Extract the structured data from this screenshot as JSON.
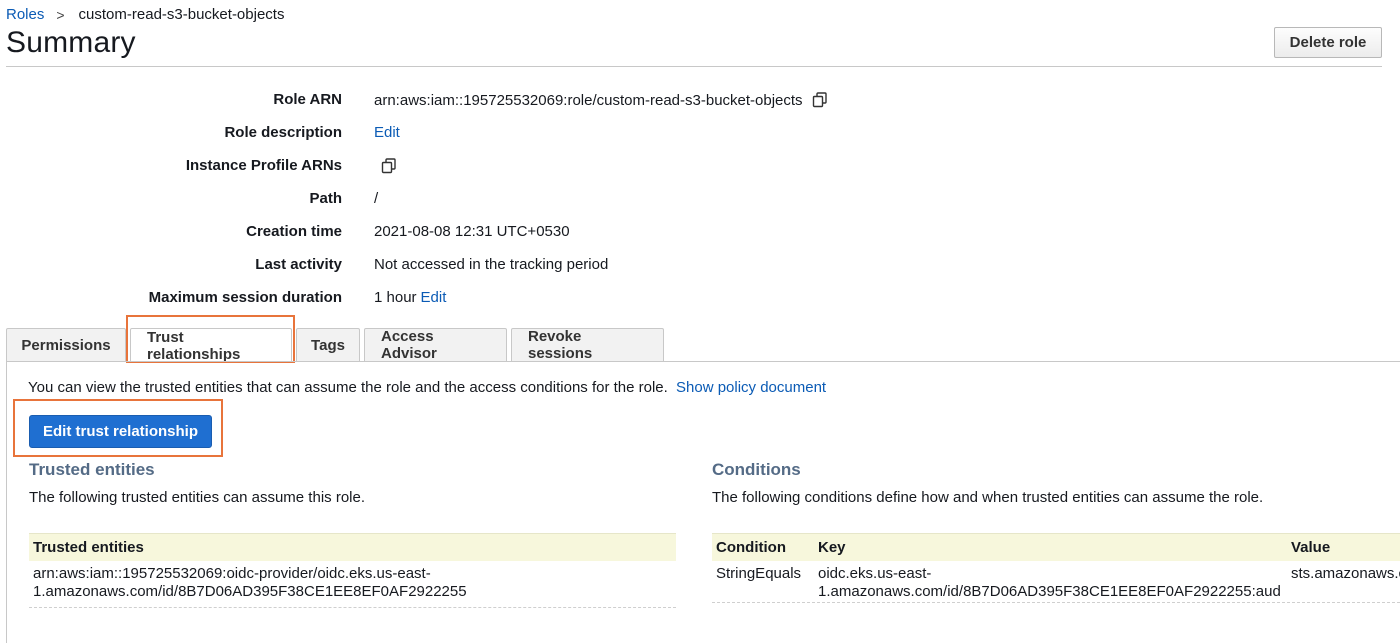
{
  "breadcrumb": {
    "parent": "Roles",
    "separator": ">",
    "current": "custom-read-s3-bucket-objects"
  },
  "page_title": "Summary",
  "delete_button": "Delete role",
  "summary": {
    "role_arn_label": "Role ARN",
    "role_arn_value": "arn:aws:iam::195725532069:role/custom-read-s3-bucket-objects",
    "role_description_label": "Role description",
    "role_description_edit": "Edit",
    "instance_profile_label": "Instance Profile ARNs",
    "path_label": "Path",
    "path_value": "/",
    "creation_time_label": "Creation time",
    "creation_time_value": "2021-08-08 12:31 UTC+0530",
    "last_activity_label": "Last activity",
    "last_activity_value": "Not accessed in the tracking period",
    "max_session_label": "Maximum session duration",
    "max_session_value": "1 hour",
    "max_session_edit": "Edit"
  },
  "tabs": [
    "Permissions",
    "Trust relationships",
    "Tags",
    "Access Advisor",
    "Revoke sessions"
  ],
  "active_tab": "Trust relationships",
  "trust": {
    "intro": "You can view the trusted entities that can assume the role and the access conditions for the role.",
    "show_policy_link": "Show policy document",
    "edit_button": "Edit trust relationship",
    "trusted_entities_title": "Trusted entities",
    "trusted_entities_desc": "The following trusted entities can assume this role.",
    "trusted_entities_header": "Trusted entities",
    "trusted_entities_rows": [
      {
        "line1": "arn:aws:iam::195725532069:oidc-provider/oidc.eks.us-east-",
        "line2": "1.amazonaws.com/id/8B7D06AD395F38CE1EE8EF0AF2922255"
      }
    ],
    "conditions_title": "Conditions",
    "conditions_desc": "The following conditions define how and when trusted entities can assume the role.",
    "conditions_headers": {
      "condition": "Condition",
      "key": "Key",
      "value": "Value"
    },
    "conditions_rows": [
      {
        "condition": "StringEquals",
        "key_line1": "oidc.eks.us-east-",
        "key_line2": "1.amazonaws.com/id/8B7D06AD395F38CE1EE8EF0AF2922255:aud",
        "value": "sts.amazonaws.com"
      }
    ]
  },
  "colors": {
    "link": "#0b5bb5",
    "primary_button": "#1f6fd1",
    "highlight_box": "#e8743b",
    "section_title": "#546b86",
    "table_header_bg": "#f7f7dc"
  },
  "icons": {
    "copy": "copy-icon"
  }
}
